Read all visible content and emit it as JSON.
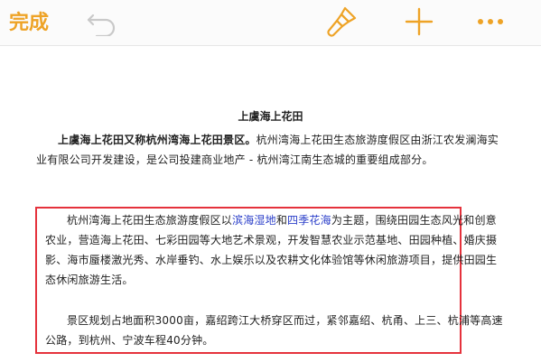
{
  "toolbar": {
    "done_label": "完成",
    "accent_color": "#eea326",
    "icons": [
      "undo-icon",
      "paintbrush-icon",
      "plus-icon",
      "more-icon"
    ]
  },
  "document": {
    "title": "上虞海上花田",
    "para1": {
      "bold_lead": "上虞海上花田又称杭州湾海上花田景区。",
      "rest": "杭州湾海上花田生态旅游度假区由浙江农发澜海实业有限公司开发建设，是公司投建商业地产 - 杭州湾江南生态城的重要组成部分。"
    },
    "para2": {
      "pre": "杭州湾海上花田生态旅游度假区以",
      "hl1": "滨海湿地",
      "mid": "和",
      "hl2": "四季花海",
      "post": "为主题，围绕田园生态风光和创意农业，营造海上花田、七彩田园等大地艺术景观，开发智慧农业示范基地、田园种植、婚庆摄影、海市蜃楼激光秀、水岸垂钓、水上娱乐以及农耕文化体验馆等休闲旅游项目，提供田园生态休闲旅游生活。"
    },
    "para3": "景区规划占地面积3000亩，嘉绍跨江大桥穿区而过，紧邻嘉绍、杭甬、上三、杭浦等高速公路，到杭州、宁波车程40分钟。",
    "highlight_color": "#2b3fc9",
    "box_color": "#e5323c"
  }
}
